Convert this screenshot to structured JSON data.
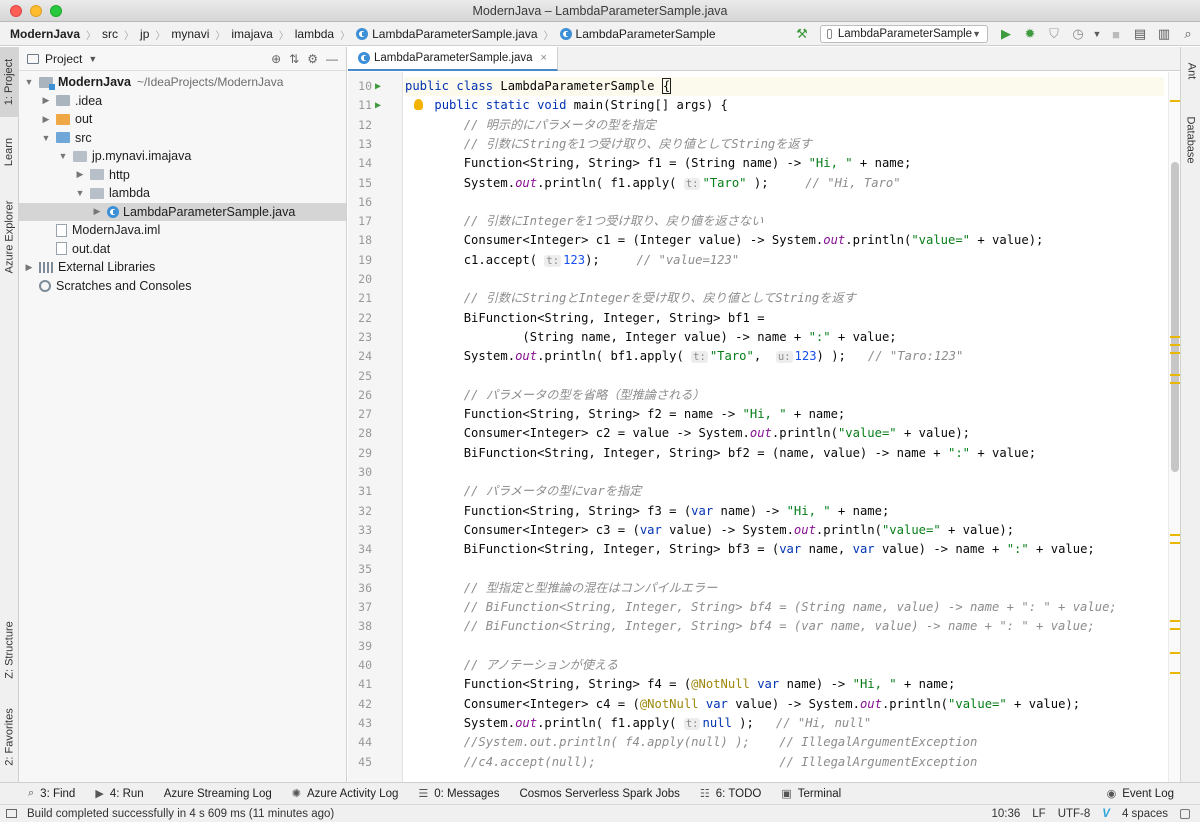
{
  "window": {
    "title": "ModernJava – LambdaParameterSample.java"
  },
  "breadcrumb": [
    "ModernJava",
    "src",
    "jp",
    "mynavi",
    "imajava",
    "lambda",
    "LambdaParameterSample.java",
    "LambdaParameterSample"
  ],
  "run_config": {
    "label": "LambdaParameterSample"
  },
  "left_tabs": [
    {
      "label": "1: Project"
    },
    {
      "label": "Learn"
    },
    {
      "label": "Azure Explorer"
    },
    {
      "label": "Z: Structure"
    },
    {
      "label": "2: Favorites"
    }
  ],
  "right_tabs": [
    {
      "label": "Ant"
    },
    {
      "label": "Database"
    }
  ],
  "project_panel": {
    "title": "Project",
    "tree": [
      {
        "label": "ModernJava",
        "path": "~/IdeaProjects/ModernJava",
        "depth": 0,
        "arrow": "▼",
        "icon": "module"
      },
      {
        "label": ".idea",
        "path": "",
        "depth": 1,
        "arrow": "▶",
        "icon": "folder"
      },
      {
        "label": "out",
        "path": "",
        "depth": 1,
        "arrow": "▶",
        "icon": "orange"
      },
      {
        "label": "src",
        "path": "",
        "depth": 1,
        "arrow": "▼",
        "icon": "blue"
      },
      {
        "label": "jp.mynavi.imajava",
        "path": "",
        "depth": 2,
        "arrow": "▼",
        "icon": "pkg"
      },
      {
        "label": "http",
        "path": "",
        "depth": 3,
        "arrow": "▶",
        "icon": "pkg"
      },
      {
        "label": "lambda",
        "path": "",
        "depth": 3,
        "arrow": "▼",
        "icon": "pkg"
      },
      {
        "label": "LambdaParameterSample.java",
        "path": "",
        "depth": 4,
        "arrow": "▶",
        "icon": "class"
      },
      {
        "label": "ModernJava.iml",
        "path": "",
        "depth": 1,
        "arrow": "",
        "icon": "file"
      },
      {
        "label": "out.dat",
        "path": "",
        "depth": 1,
        "arrow": "",
        "icon": "file"
      },
      {
        "label": "External Libraries",
        "path": "",
        "depth": 0,
        "arrow": "▶",
        "icon": "libs"
      },
      {
        "label": "Scratches and Consoles",
        "path": "",
        "depth": 0,
        "arrow": "",
        "icon": "scratch"
      }
    ]
  },
  "editor": {
    "tab_label": "LambdaParameterSample.java",
    "lines": [
      {
        "n": "10",
        "run": true,
        "current": true,
        "tokens": [
          [
            "kw",
            "public class "
          ],
          [
            "",
            "LambdaParameterSample "
          ],
          [
            "caret",
            "{"
          ]
        ]
      },
      {
        "n": "11",
        "run": true,
        "current": false,
        "tokens": [
          [
            "",
            "    "
          ],
          [
            "kw",
            "public static void "
          ],
          [
            "",
            "main(String[] args) {"
          ]
        ]
      },
      {
        "n": "12",
        "tokens": [
          [
            "",
            "        "
          ],
          [
            "cm",
            "// 明示的にパラメータの型を指定"
          ]
        ]
      },
      {
        "n": "13",
        "tokens": [
          [
            "",
            "        "
          ],
          [
            "cm",
            "// 引数にStringを1つ受け取り、戻り値としてStringを返す"
          ]
        ]
      },
      {
        "n": "14",
        "tokens": [
          [
            "",
            "        Function<String, String> f1 = (String name) -> "
          ],
          [
            "str",
            "\"Hi, \""
          ],
          [
            "",
            " + name;"
          ]
        ]
      },
      {
        "n": "15",
        "tokens": [
          [
            "",
            "        System."
          ],
          [
            "fld",
            "out"
          ],
          [
            "",
            ".println( f1.apply( "
          ],
          [
            "hint",
            "t:"
          ],
          [
            "str",
            "\"Taro\""
          ],
          [
            "",
            " );     "
          ],
          [
            "cm",
            "// \"Hi, Taro\""
          ]
        ]
      },
      {
        "n": "16",
        "tokens": []
      },
      {
        "n": "17",
        "tokens": [
          [
            "",
            "        "
          ],
          [
            "cm",
            "// 引数にIntegerを1つ受け取り、戻り値を返さない"
          ]
        ]
      },
      {
        "n": "18",
        "tokens": [
          [
            "",
            "        Consumer<Integer> c1 = (Integer value) -> System."
          ],
          [
            "fld",
            "out"
          ],
          [
            "",
            ".println("
          ],
          [
            "str",
            "\"value=\""
          ],
          [
            "",
            " + value);"
          ]
        ]
      },
      {
        "n": "19",
        "tokens": [
          [
            "",
            "        c1.accept( "
          ],
          [
            "hint",
            "t:"
          ],
          [
            "num",
            "123"
          ],
          [
            "",
            ");     "
          ],
          [
            "cm",
            "// \"value=123\""
          ]
        ]
      },
      {
        "n": "20",
        "tokens": []
      },
      {
        "n": "21",
        "tokens": [
          [
            "",
            "        "
          ],
          [
            "cm",
            "// 引数にStringとIntegerを受け取り、戻り値としてStringを返す"
          ]
        ]
      },
      {
        "n": "22",
        "tokens": [
          [
            "",
            "        BiFunction<String, Integer, String> bf1 ="
          ]
        ]
      },
      {
        "n": "23",
        "tokens": [
          [
            "",
            "                (String name, Integer value) -> name + "
          ],
          [
            "str",
            "\":\""
          ],
          [
            "",
            " + value;"
          ]
        ]
      },
      {
        "n": "24",
        "tokens": [
          [
            "",
            "        System."
          ],
          [
            "fld",
            "out"
          ],
          [
            "",
            ".println( bf1.apply( "
          ],
          [
            "hint",
            "t:"
          ],
          [
            "str",
            "\"Taro\""
          ],
          [
            "",
            ",  "
          ],
          [
            "hint",
            "u:"
          ],
          [
            "num",
            "123"
          ],
          [
            "",
            ") );   "
          ],
          [
            "cm",
            "// \"Taro:123\""
          ]
        ]
      },
      {
        "n": "25",
        "tokens": []
      },
      {
        "n": "26",
        "tokens": [
          [
            "",
            "        "
          ],
          [
            "cm",
            "// パラメータの型を省略（型推論される）"
          ]
        ]
      },
      {
        "n": "27",
        "tokens": [
          [
            "",
            "        Function<String, String> f2 = name -> "
          ],
          [
            "str",
            "\"Hi, \""
          ],
          [
            "",
            " + name;"
          ]
        ]
      },
      {
        "n": "28",
        "tokens": [
          [
            "",
            "        Consumer<Integer> c2 = value -> System."
          ],
          [
            "fld",
            "out"
          ],
          [
            "",
            ".println("
          ],
          [
            "str",
            "\"value=\""
          ],
          [
            "",
            " + value);"
          ]
        ]
      },
      {
        "n": "29",
        "tokens": [
          [
            "",
            "        BiFunction<String, Integer, String> bf2 = (name, value) -> name + "
          ],
          [
            "str",
            "\":\""
          ],
          [
            "",
            " + value;"
          ]
        ]
      },
      {
        "n": "30",
        "tokens": []
      },
      {
        "n": "31",
        "tokens": [
          [
            "",
            "        "
          ],
          [
            "cm",
            "// パラメータの型にvarを指定"
          ]
        ]
      },
      {
        "n": "32",
        "tokens": [
          [
            "",
            "        Function<String, String> f3 = ("
          ],
          [
            "kw",
            "var"
          ],
          [
            "",
            " name) -> "
          ],
          [
            "str",
            "\"Hi, \""
          ],
          [
            "",
            " + name;"
          ]
        ]
      },
      {
        "n": "33",
        "tokens": [
          [
            "",
            "        Consumer<Integer> c3 = ("
          ],
          [
            "kw",
            "var"
          ],
          [
            "",
            " value) -> System."
          ],
          [
            "fld",
            "out"
          ],
          [
            "",
            ".println("
          ],
          [
            "str",
            "\"value=\""
          ],
          [
            "",
            " + value);"
          ]
        ]
      },
      {
        "n": "34",
        "tokens": [
          [
            "",
            "        BiFunction<String, Integer, String> bf3 = ("
          ],
          [
            "kw",
            "var"
          ],
          [
            "",
            " name, "
          ],
          [
            "kw",
            "var"
          ],
          [
            "",
            " value) -> name + "
          ],
          [
            "str",
            "\":\""
          ],
          [
            "",
            " + value;"
          ]
        ]
      },
      {
        "n": "35",
        "tokens": []
      },
      {
        "n": "36",
        "tokens": [
          [
            "",
            "        "
          ],
          [
            "cm",
            "// 型指定と型推論の混在はコンパイルエラー"
          ]
        ]
      },
      {
        "n": "37",
        "tokens": [
          [
            "",
            "        "
          ],
          [
            "cm",
            "// BiFunction<String, Integer, String> bf4 = (String name, value) -> name + \": \" + value;"
          ]
        ]
      },
      {
        "n": "38",
        "tokens": [
          [
            "",
            "        "
          ],
          [
            "cm",
            "// BiFunction<String, Integer, String> bf4 = (var name, value) -> name + \": \" + value;"
          ]
        ]
      },
      {
        "n": "39",
        "tokens": []
      },
      {
        "n": "40",
        "tokens": [
          [
            "",
            "        "
          ],
          [
            "cm",
            "// アノテーションが使える"
          ]
        ]
      },
      {
        "n": "41",
        "tokens": [
          [
            "",
            "        Function<String, String> f4 = ("
          ],
          [
            "ann",
            "@NotNull "
          ],
          [
            "kw",
            "var"
          ],
          [
            "",
            " name) -> "
          ],
          [
            "str",
            "\"Hi, \""
          ],
          [
            "",
            " + name;"
          ]
        ]
      },
      {
        "n": "42",
        "tokens": [
          [
            "",
            "        Consumer<Integer> c4 = ("
          ],
          [
            "ann",
            "@NotNull "
          ],
          [
            "kw",
            "var"
          ],
          [
            "",
            " value) -> System."
          ],
          [
            "fld",
            "out"
          ],
          [
            "",
            ".println("
          ],
          [
            "str",
            "\"value=\""
          ],
          [
            "",
            " + value);"
          ]
        ]
      },
      {
        "n": "43",
        "tokens": [
          [
            "",
            "        System."
          ],
          [
            "fld",
            "out"
          ],
          [
            "",
            ".println( f1.apply( "
          ],
          [
            "hint",
            "t:"
          ],
          [
            "kw",
            "null"
          ],
          [
            "",
            " );   "
          ],
          [
            "cm",
            "// \"Hi, null\""
          ]
        ]
      },
      {
        "n": "44",
        "tokens": [
          [
            "",
            "        "
          ],
          [
            "cm",
            "//System.out.println( f4.apply(null) );    // IllegalArgumentException"
          ]
        ]
      },
      {
        "n": "45",
        "tokens": [
          [
            "",
            "        "
          ],
          [
            "cm",
            "//c4.accept(null);                         // IllegalArgumentException"
          ]
        ]
      }
    ]
  },
  "tool_windows": [
    {
      "label": "3: Find",
      "icon": "⌕"
    },
    {
      "label": "4: Run",
      "icon": "▶"
    },
    {
      "label": "Azure Streaming Log",
      "icon": ""
    },
    {
      "label": "Azure Activity Log",
      "icon": "✺"
    },
    {
      "label": "0: Messages",
      "icon": "☰"
    },
    {
      "label": "Cosmos Serverless Spark Jobs",
      "icon": ""
    },
    {
      "label": "6: TODO",
      "icon": "☷"
    },
    {
      "label": "Terminal",
      "icon": "▣"
    }
  ],
  "event_log": {
    "label": "Event Log"
  },
  "status": {
    "message": "Build completed successfully in 4 s 609 ms (11 minutes ago)",
    "position": "10:36",
    "line_sep": "LF",
    "encoding": "UTF-8",
    "indent": "4 spaces"
  },
  "colors": {
    "keyword": "#0033b3",
    "string": "#067d17",
    "comment": "#8c8c8c",
    "annotation": "#9e880d",
    "static_field": "#871094",
    "number": "#1750eb",
    "run_green": "#3d9a3d",
    "accent": "#4a88c7"
  }
}
